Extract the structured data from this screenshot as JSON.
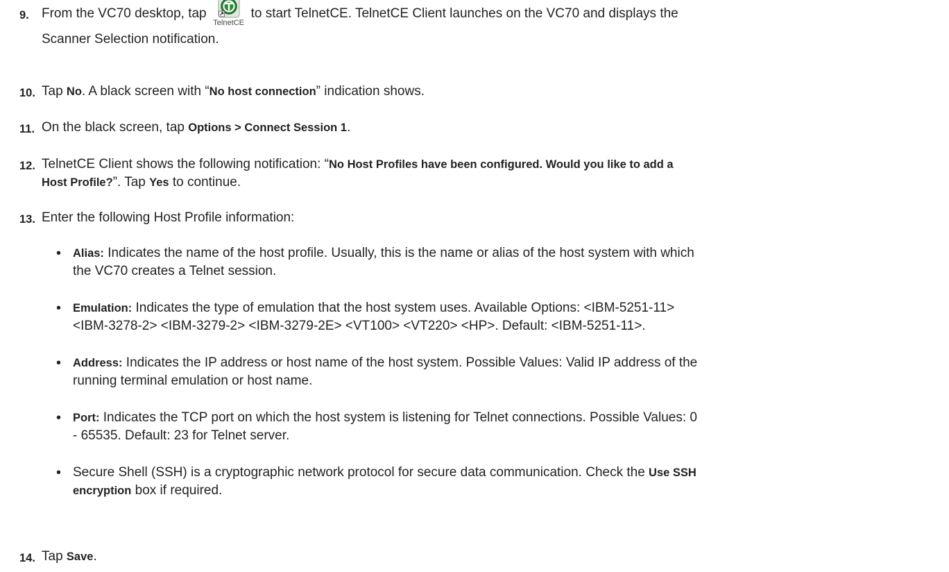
{
  "steps": {
    "s9": {
      "num": "9.",
      "text_before": "From the VC70 desktop, tap",
      "text_after": "to start TelnetCE. TelnetCE Client launches on the VC70 and displays the",
      "line2": "Scanner Selection notification.",
      "icon": {
        "name": "telnetce-app-icon",
        "caption": "TelnetCE",
        "color": "#2e8b3a"
      }
    },
    "s10": {
      "num": "10.",
      "t1": "Tap ",
      "b1": "No",
      "t2": ". A black screen with “",
      "b2": "No host connection",
      "t3": "” indication shows."
    },
    "s11": {
      "num": "11.",
      "t1": "On the black screen, tap ",
      "b1": "Options > Connect Session 1",
      "t2": "."
    },
    "s12": {
      "num": "12.",
      "t1": "TelnetCE Client shows the following notification: “",
      "b1": "No Host Profiles have been configured. Would you like to add a",
      "b2": "Host Profile?",
      "t2": "”. Tap ",
      "b3": "Yes",
      "t3": " to continue."
    },
    "s13": {
      "num": "13.",
      "text": "Enter the following Host Profile information:"
    },
    "s14": {
      "num": "14.",
      "t1": "Tap ",
      "b1": "Save",
      "t2": "."
    }
  },
  "bullets": {
    "alias": {
      "term": "Alias:",
      "line1": " Indicates the name of the host profile. Usually, this is the name or alias of the host system with which",
      "line2": "the VC70 creates a Telnet session."
    },
    "emulation": {
      "term": "Emulation:",
      "line1": " Indicates the type of emulation that the host system uses. Available Options: <IBM-5251-11>",
      "line2": "<IBM-3278-2> <IBM-3279-2> <IBM-3279-2E> <VT100> <VT220> <HP>. Default: <IBM-5251-11>."
    },
    "address": {
      "term": "Address:",
      "line1": " Indicates the IP address or host name of the host system. Possible Values: Valid IP address of the",
      "line2": "running terminal emulation or host name."
    },
    "port": {
      "term": "Port:",
      "line1": " Indicates the TCP port on which the host system is listening for Telnet connections. Possible Values: 0",
      "line2": "- 65535. Default: 23 for Telnet server."
    },
    "ssh": {
      "line1a": "Secure Shell (SSH) is a cryptographic network protocol for secure data communication. Check the ",
      "b1": "Use SSH",
      "b2": "encryption",
      "line2b": " box if required."
    }
  }
}
